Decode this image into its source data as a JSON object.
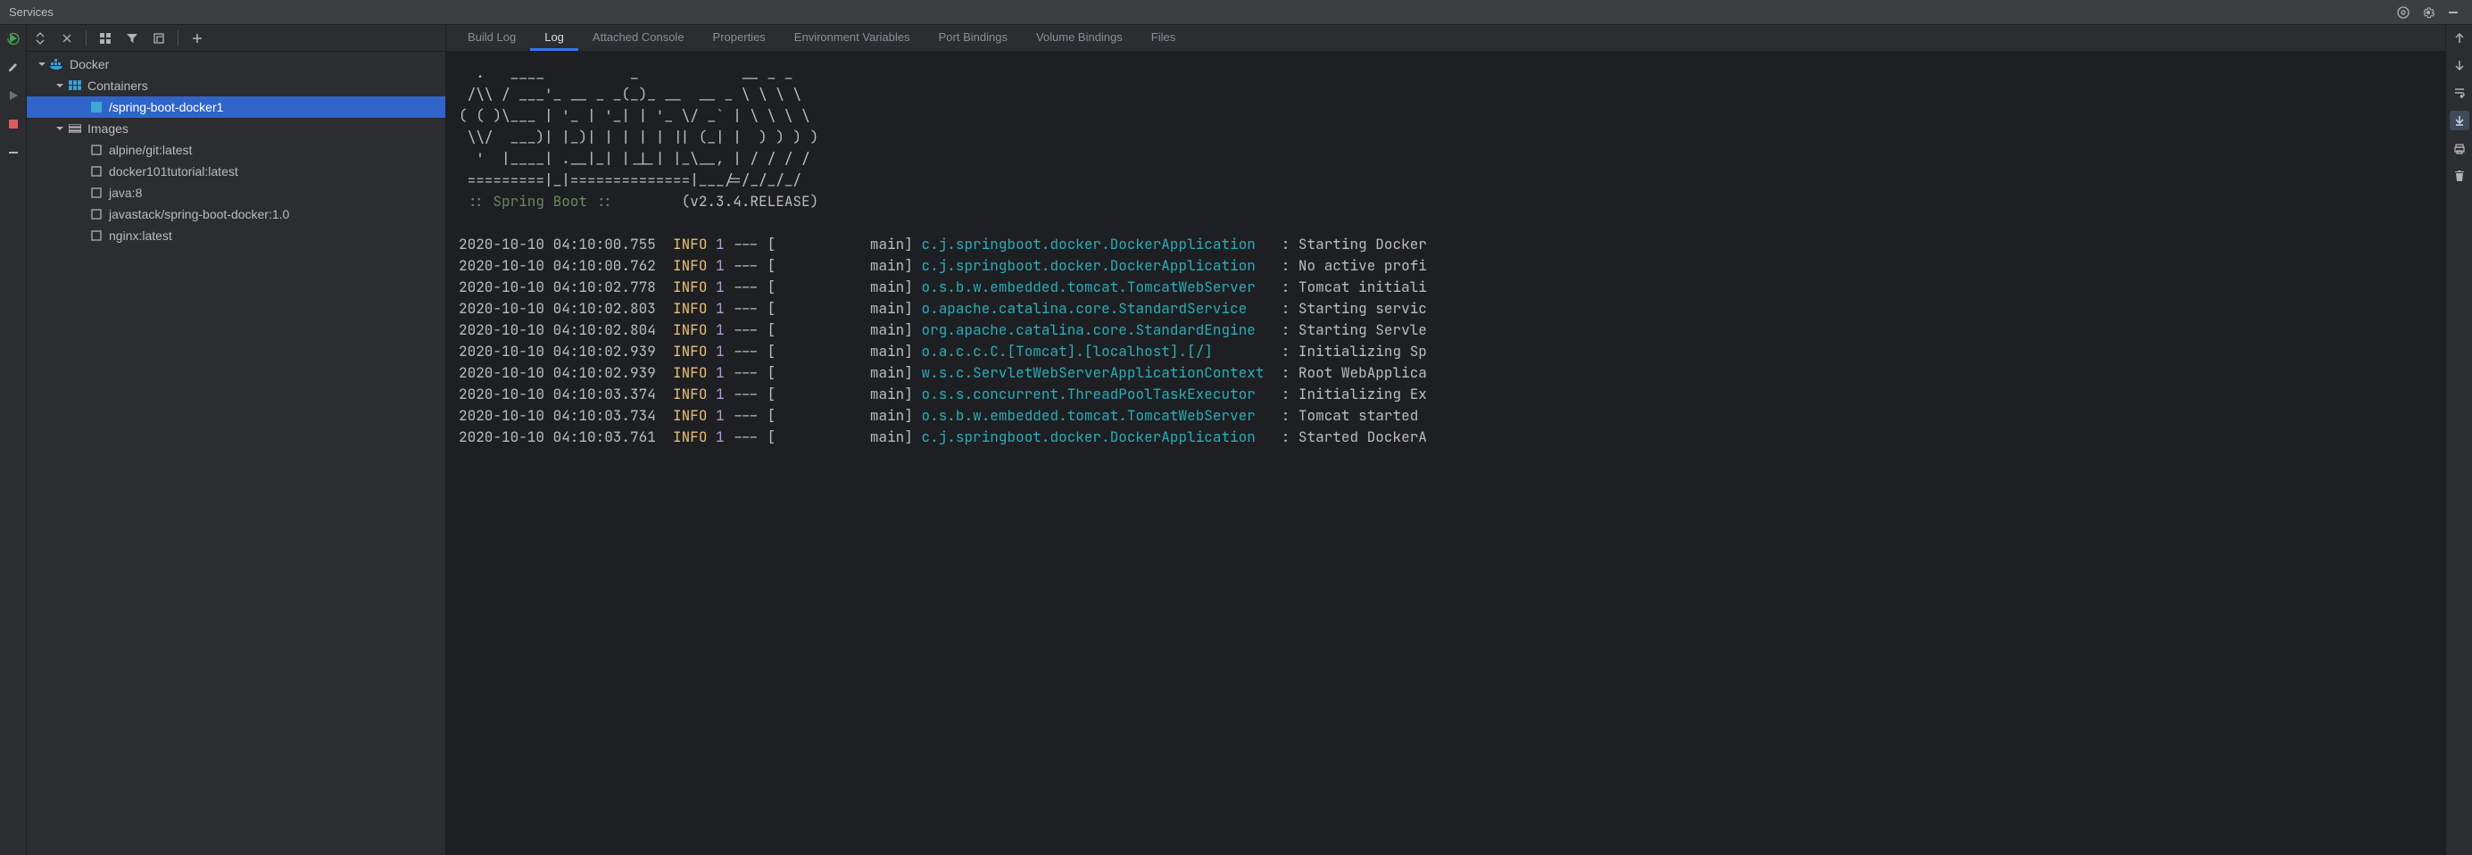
{
  "title": "Services",
  "tabs": [
    "Build Log",
    "Log",
    "Attached Console",
    "Properties",
    "Environment Variables",
    "Port Bindings",
    "Volume Bindings",
    "Files"
  ],
  "active_tab_index": 1,
  "tree": {
    "root": "Docker",
    "containers_label": "Containers",
    "selected_container": "/spring-boot-docker1",
    "images_label": "Images",
    "images": [
      "alpine/git:latest",
      "docker101tutorial:latest",
      "java:8",
      "javastack/spring-boot-docker:1.0",
      "nginx:latest"
    ]
  },
  "banner": [
    "  .   ____          _            __ _ _",
    " /\\\\ / ___'_ __ _ _(_)_ __  __ _ \\ \\ \\ \\",
    "( ( )\\___ | '_ | '_| | '_ \\/ _` | \\ \\ \\ \\",
    " \\\\/  ___)| |_)| | | | | || (_| |  ) ) ) )",
    "  '  |____| .__|_| |_|_| |_\\__, | / / / /",
    " =========|_|==============|___/=/_/_/_/"
  ],
  "banner_app": " :: Spring Boot ::",
  "banner_version": "(v2.3.4.RELEASE)",
  "log_lines": [
    {
      "ts": "2020-10-10 04:10:00.755",
      "level": "INFO",
      "pid": "1",
      "sep": "--- [",
      "thread": "main]",
      "logger": "c.j.springboot.docker.DockerApplication  ",
      "msg": ": Starting Docker"
    },
    {
      "ts": "2020-10-10 04:10:00.762",
      "level": "INFO",
      "pid": "1",
      "sep": "--- [",
      "thread": "main]",
      "logger": "c.j.springboot.docker.DockerApplication  ",
      "msg": ": No active profi"
    },
    {
      "ts": "2020-10-10 04:10:02.778",
      "level": "INFO",
      "pid": "1",
      "sep": "--- [",
      "thread": "main]",
      "logger": "o.s.b.w.embedded.tomcat.TomcatWebServer  ",
      "msg": ": Tomcat initiali"
    },
    {
      "ts": "2020-10-10 04:10:02.803",
      "level": "INFO",
      "pid": "1",
      "sep": "--- [",
      "thread": "main]",
      "logger": "o.apache.catalina.core.StandardService   ",
      "msg": ": Starting servic"
    },
    {
      "ts": "2020-10-10 04:10:02.804",
      "level": "INFO",
      "pid": "1",
      "sep": "--- [",
      "thread": "main]",
      "logger": "org.apache.catalina.core.StandardEngine  ",
      "msg": ": Starting Servle"
    },
    {
      "ts": "2020-10-10 04:10:02.939",
      "level": "INFO",
      "pid": "1",
      "sep": "--- [",
      "thread": "main]",
      "logger": "o.a.c.c.C.[Tomcat].[localhost].[/]       ",
      "msg": ": Initializing Sp"
    },
    {
      "ts": "2020-10-10 04:10:02.939",
      "level": "INFO",
      "pid": "1",
      "sep": "--- [",
      "thread": "main]",
      "logger": "w.s.c.ServletWebServerApplicationContext ",
      "msg": ": Root WebApplica"
    },
    {
      "ts": "2020-10-10 04:10:03.374",
      "level": "INFO",
      "pid": "1",
      "sep": "--- [",
      "thread": "main]",
      "logger": "o.s.s.concurrent.ThreadPoolTaskExecutor  ",
      "msg": ": Initializing Ex"
    },
    {
      "ts": "2020-10-10 04:10:03.734",
      "level": "INFO",
      "pid": "1",
      "sep": "--- [",
      "thread": "main]",
      "logger": "o.s.b.w.embedded.tomcat.TomcatWebServer  ",
      "msg": ": Tomcat started "
    },
    {
      "ts": "2020-10-10 04:10:03.761",
      "level": "INFO",
      "pid": "1",
      "sep": "--- [",
      "thread": "main]",
      "logger": "c.j.springboot.docker.DockerApplication  ",
      "msg": ": Started DockerA"
    }
  ]
}
